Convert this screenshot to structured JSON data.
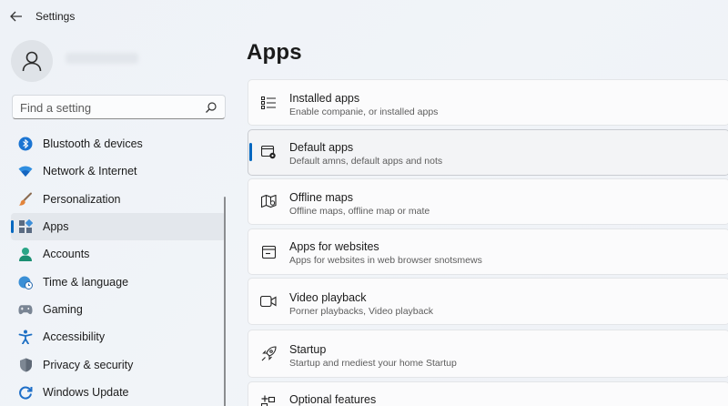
{
  "window": {
    "title": "Settings"
  },
  "search": {
    "placeholder": "Find a setting"
  },
  "sidebar": {
    "items": [
      {
        "label": "Blustooth & devices",
        "icon": "bluetooth-icon"
      },
      {
        "label": "Network & Internet",
        "icon": "wifi-icon"
      },
      {
        "label": "Personalization",
        "icon": "brush-icon"
      },
      {
        "label": "Apps",
        "icon": "apps-icon",
        "active": true
      },
      {
        "label": "Accounts",
        "icon": "accounts-icon"
      },
      {
        "label": "Time & language",
        "icon": "globe-clock-icon"
      },
      {
        "label": "Gaming",
        "icon": "gamepad-icon"
      },
      {
        "label": "Accessibility",
        "icon": "accessibility-icon"
      },
      {
        "label": "Privacy & security",
        "icon": "shield-icon"
      },
      {
        "label": "Windows Update",
        "icon": "update-icon"
      }
    ]
  },
  "main": {
    "title": "Apps",
    "cards": [
      {
        "title": "Installed apps",
        "subtitle": "Enable companie, or installed apps",
        "icon": "list-icon"
      },
      {
        "title": "Default apps",
        "subtitle": "Default amns, default apps and nots",
        "icon": "default-apps-icon",
        "selected": true
      },
      {
        "title": "Offline maps",
        "subtitle": "Offline maps, offline map or mate",
        "icon": "map-icon"
      },
      {
        "title": "Apps for websites",
        "subtitle": "Apps for websites in web browser snotsmews",
        "icon": "web-window-icon"
      },
      {
        "title": "Video playback",
        "subtitle": "Porner playbacks, Video playback",
        "icon": "video-icon"
      },
      {
        "title": "Startup",
        "subtitle": "Startup and rnediest your home Startup",
        "icon": "rocket-icon"
      },
      {
        "title": "Optional features",
        "subtitle": "",
        "icon": "add-feature-icon"
      }
    ]
  },
  "colors": {
    "accent": "#0067c0",
    "background": "#eff2f6",
    "card": "#fbfbfc"
  }
}
